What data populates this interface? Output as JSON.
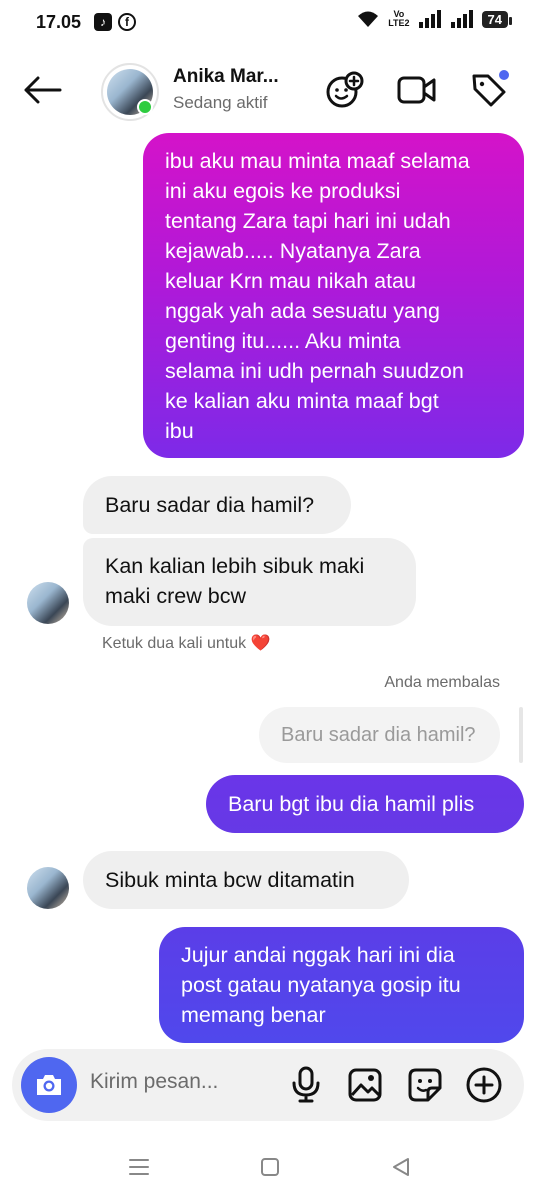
{
  "status_bar": {
    "time": "17.05",
    "volte_line1": "Vo",
    "volte_line2": "LTE2",
    "battery": "74",
    "icons": [
      "tiktok-icon",
      "facebook-icon",
      "wifi-icon",
      "volte-icon",
      "signal-icon",
      "signal-icon",
      "battery-icon"
    ]
  },
  "header": {
    "contact_name": "Anika Mar...",
    "contact_status": "Sedang aktif",
    "icons": [
      "back-arrow-icon",
      "avatar",
      "effects-icon",
      "video-call-icon",
      "tag-icon"
    ],
    "accent_dot_color": "#4f67f0"
  },
  "messages": [
    {
      "side": "sent",
      "lines": [
        "ibu aku mau minta maaf selama",
        "ini aku egois ke produksi",
        "tentang Zara tapi hari ini udah",
        "kejawab..... Nyatanya Zara",
        "keluar Krn mau nikah atau",
        "nggak yah ada sesuatu yang",
        "genting itu...... Aku minta",
        "selama ini udh pernah suudzon",
        "ke kalian aku minta maaf bgt",
        "ibu"
      ]
    },
    {
      "side": "received",
      "lines": [
        "Baru sadar dia hamil?"
      ]
    },
    {
      "side": "received",
      "lines": [
        "Kan kalian lebih sibuk maki",
        "maki crew bcw"
      ]
    },
    {
      "side": "sent",
      "lines": [
        "Baru bgt ibu dia hamil plis"
      ],
      "reply_to": "Baru sadar dia hamil?"
    },
    {
      "side": "received",
      "lines": [
        "Sibuk minta bcw ditamatin"
      ]
    },
    {
      "side": "sent",
      "lines": [
        "Jujur andai nggak hari ini dia",
        "post gatau nyatanya gosip itu",
        "memang benar"
      ]
    }
  ],
  "hints": {
    "double_tap": "Ketuk dua kali untuk",
    "double_tap_emoji": "❤️",
    "you_replied": "Anda membalas"
  },
  "composer": {
    "placeholder": "Kirim pesan...",
    "icons": [
      "camera-icon",
      "microphone-icon",
      "gallery-icon",
      "sticker-icon",
      "add-icon"
    ]
  },
  "nav_bar": {
    "icons": [
      "recents-icon",
      "home-icon",
      "back-icon"
    ]
  },
  "colors": {
    "sent_gradient_top": "#d413c9",
    "sent_gradient_bottom": "#7d2ae8",
    "sent_solid": "#6a35e8",
    "received": "#efefef",
    "online": "#2ecc40",
    "camera_button": "#4f67f0"
  }
}
